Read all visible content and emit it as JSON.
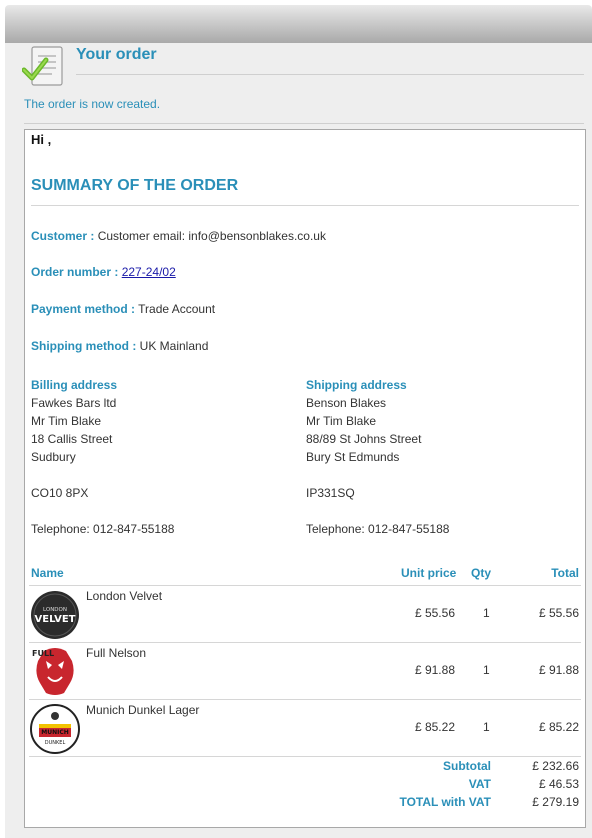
{
  "header": {
    "title": "Your order",
    "status_message": "The order is now created."
  },
  "greeting": "Hi ,",
  "summary_title": "SUMMARY OF THE ORDER",
  "info": {
    "customer_label": "Customer :",
    "customer_value": "Customer email: info@bensonblakes.co.uk",
    "order_number_label": "Order number :",
    "order_number_value": "227-24/02",
    "payment_label": "Payment method :",
    "payment_value": "Trade Account",
    "shipping_label": "Shipping method :",
    "shipping_value": "UK Mainland"
  },
  "billing": {
    "heading": "Billing address",
    "company": "Fawkes Bars ltd",
    "name": "Mr Tim Blake",
    "street": "18 Callis Street",
    "city": "Sudbury",
    "postcode": "CO10 8PX",
    "telephone": "Telephone: 012-847-55188"
  },
  "shipping": {
    "heading": "Shipping address",
    "company": "Benson Blakes",
    "name": "Mr Tim Blake",
    "street": "88/89 St Johns Street",
    "city": "Bury St Edmunds",
    "postcode": "IP331SQ",
    "telephone": "Telephone: 012-847-55188"
  },
  "table": {
    "col_name": "Name",
    "col_unit_price": "Unit price",
    "col_qty": "Qty",
    "col_total": "Total",
    "items": [
      {
        "name": "London Velvet",
        "unit_price": "£ 55.56",
        "qty": "1",
        "total": "£ 55.56",
        "logo_text": "LONDON VELVET",
        "icon": "london-velvet-logo"
      },
      {
        "name": "Full Nelson",
        "unit_price": "£ 91.88",
        "qty": "1",
        "total": "£ 91.88",
        "logo_text": "FULL",
        "icon": "full-nelson-logo"
      },
      {
        "name": "Munich Dunkel Lager",
        "unit_price": "£ 85.22",
        "qty": "1",
        "total": "£ 85.22",
        "logo_text": "MUNICH DUNKEL",
        "icon": "munich-dunkel-logo"
      }
    ]
  },
  "totals": {
    "subtotal_label": "Subtotal",
    "subtotal_value": "£ 232.66",
    "vat_label": "VAT",
    "vat_value": "£ 46.53",
    "total_label": "TOTAL with VAT",
    "total_value": "£ 279.19"
  },
  "colors": {
    "accent": "#2a8fb8",
    "link": "#1a1aa8"
  }
}
